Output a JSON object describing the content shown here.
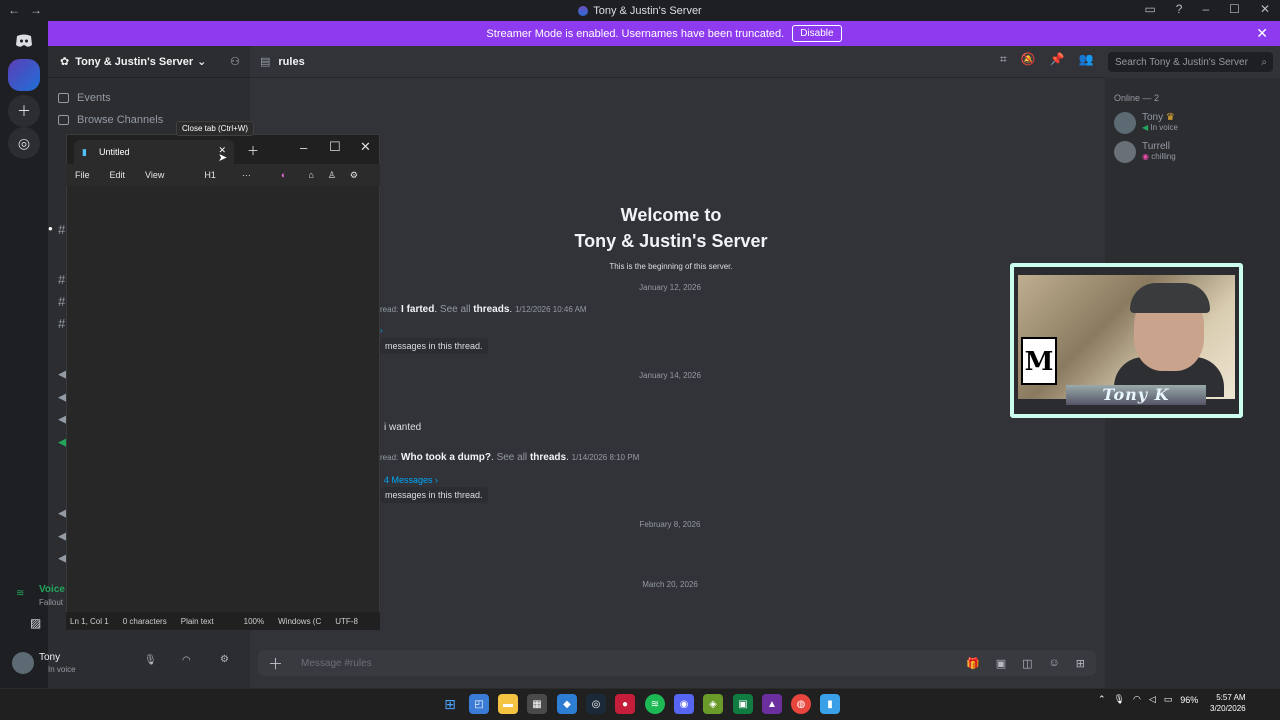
{
  "window": {
    "title": "Tony & Justin's Server"
  },
  "banner": {
    "text": "Streamer Mode is enabled. Usernames have been truncated.",
    "disable_label": "Disable"
  },
  "sidebar": {
    "server_name": "Tony & Justin's Server",
    "items": [
      {
        "label": "Events"
      },
      {
        "label": "Browse Channels"
      }
    ],
    "voice_title": "Voice",
    "voice_sub": "Fallout"
  },
  "channel": {
    "name": "rules"
  },
  "search": {
    "placeholder": "Search Tony & Justin's Server"
  },
  "members": {
    "heading": "Online — 2",
    "list": [
      {
        "name": "Tony",
        "status": "In voice"
      },
      {
        "name": "Turrell",
        "status": "chilling"
      }
    ]
  },
  "welcome": {
    "line1": "Welcome to",
    "line2": "Tony & Justin's Server",
    "sub": "This is the beginning of this server."
  },
  "messages": {
    "date1": "January 12, 2026",
    "m1_prefix": "read:",
    "m1_title": "I farted",
    "m1_see": "See all",
    "m1_threads": "threads",
    "m1_time": "1/12/2026 10:46 AM",
    "m1_box": "messages in this thread.",
    "date2": "January 14, 2026",
    "m2_text": "i wanted",
    "m3_prefix": "read:",
    "m3_title": "Who took a dump?",
    "m3_see": "See all",
    "m3_threads": "threads",
    "m3_time": "1/14/2026 8:10 PM",
    "m3_count": "4 Messages ›",
    "m3_box": "messages in this thread.",
    "date3": "February 8, 2026",
    "date4": "March 20, 2026"
  },
  "composer": {
    "placeholder": "Message #rules"
  },
  "user": {
    "name": "Tony",
    "status": "In voice"
  },
  "webcam": {
    "name": "Tony K",
    "rating": "M"
  },
  "notepad": {
    "tab_title": "Untitled",
    "tooltip": "Close tab (Ctrl+W)",
    "menu": [
      "File",
      "Edit",
      "View"
    ],
    "heading": "H1",
    "status": [
      "Ln 1, Col 1",
      "0 characters",
      "Plain text",
      "100%",
      "Windows (C",
      "UTF-8"
    ]
  },
  "taskbar": {
    "battery": "96%",
    "time": "5:57 AM",
    "date": "3/20/2026"
  },
  "colors": {
    "accent": "#8e3bf0",
    "online": "#23a55a",
    "link": "#00a8fc"
  }
}
